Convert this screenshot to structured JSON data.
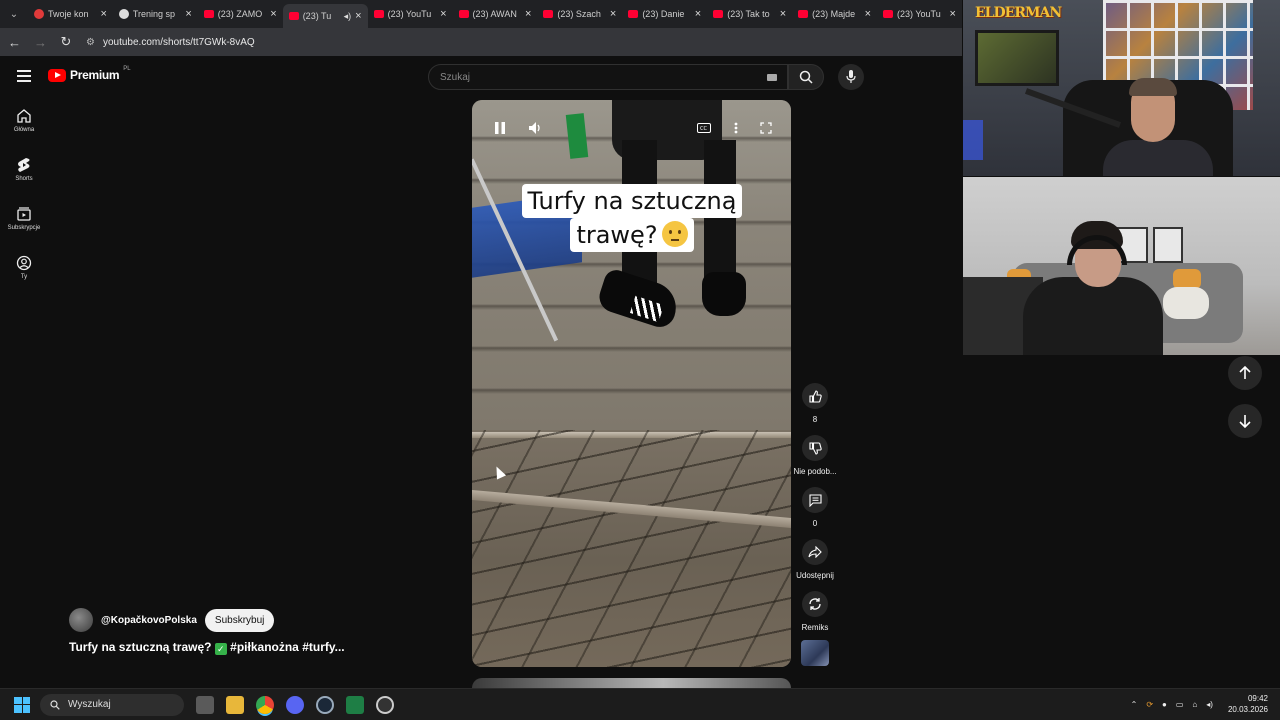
{
  "browser": {
    "tabs": [
      {
        "label": "Twoje kon",
        "favicon": "red-circle"
      },
      {
        "label": "Trening sp",
        "favicon": "ball"
      },
      {
        "label": "(23) ZAMO",
        "favicon": "youtube"
      },
      {
        "label": "(23) Tu",
        "favicon": "youtube",
        "active": true
      },
      {
        "label": "(23) YouTu",
        "favicon": "youtube"
      },
      {
        "label": "(23) AWAN",
        "favicon": "youtube"
      },
      {
        "label": "(23) Szach",
        "favicon": "youtube"
      },
      {
        "label": "(23) Danie",
        "favicon": "youtube"
      },
      {
        "label": "(23) Tak to",
        "favicon": "youtube"
      },
      {
        "label": "(23) Majde",
        "favicon": "youtube"
      },
      {
        "label": "(23) YouTu",
        "favicon": "youtube"
      }
    ],
    "url": "youtube.com/shorts/tt7GWk-8vAQ"
  },
  "header": {
    "logo_text": "Premium",
    "logo_region": "PL",
    "search_placeholder": "Szukaj"
  },
  "sidebar": {
    "items": [
      {
        "label": "Główna",
        "icon": "home-icon"
      },
      {
        "label": "Shorts",
        "icon": "shorts-icon"
      },
      {
        "label": "Subskrypcje",
        "icon": "subscriptions-icon"
      },
      {
        "label": "Ty",
        "icon": "account-icon"
      }
    ]
  },
  "video": {
    "caption_line1": "Turfy na sztuczną",
    "caption_line2": "trawę?",
    "channel": "@KopačkovoPolska",
    "subscribe_label": "Subskrybuj",
    "title_part1": "Turfy na sztuczną trawę?",
    "title_part2": "#piłkanożna #turfy..."
  },
  "actions": {
    "like_count": "8",
    "dislike_label": "Nie podob...",
    "comments_count": "0",
    "share_label": "Udostępnij",
    "remix_label": "Remiks"
  },
  "stream": {
    "logo_text": "ELDERMAN"
  },
  "taskbar": {
    "search_placeholder": "Wyszukaj",
    "time": "09:42",
    "date": "20.03.2026"
  }
}
